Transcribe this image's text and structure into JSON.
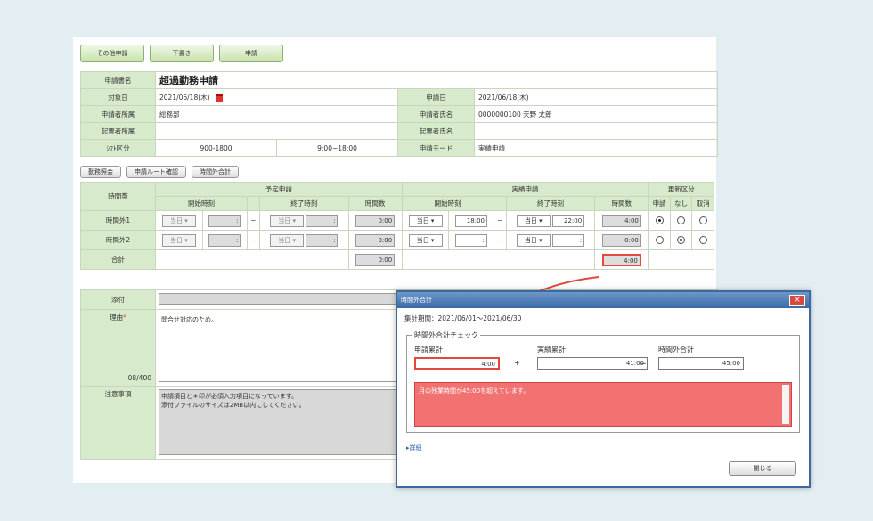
{
  "toolbar": {
    "other_label": "その他申請",
    "draft_label": "下書き",
    "apply_label": "申請"
  },
  "form": {
    "title_label": "申請書名",
    "title_value": "超過勤務申請",
    "target_date_label": "対象日",
    "target_date_value": "2021/06/18(木)",
    "apply_date_label": "申請日",
    "apply_date_value": "2021/06/18(木)",
    "dept_label": "申請者所属",
    "dept_value": "総務部",
    "applicant_label": "申請者氏名",
    "applicant_value": "0000000100 天野 太郎",
    "drafter_dept_label": "起票者所属",
    "drafter_dept_value": "",
    "drafter_label": "起票者氏名",
    "drafter_value": "",
    "shift_label": "ｼﾌﾄ区分",
    "shift_code": "900-1800",
    "shift_time": "9:00~18:00",
    "mode_label": "申請モード",
    "mode_value": "実績申請"
  },
  "subbuttons": {
    "b1": "勤務照会",
    "b2": "申請ルート確認",
    "b3": "時間外合計"
  },
  "grid": {
    "period_label": "時間帯",
    "planned_label": "予定申請",
    "actual_label": "実績申請",
    "update_label": "更新区分",
    "start_label": "開始時刻",
    "end_label": "終了時刻",
    "hours_label": "時間数",
    "apply_label": "申請",
    "none_label": "なし",
    "cancel_label": "取消",
    "day_value": "当日",
    "blank_time": ":",
    "row1_label": "時間外1",
    "row1_planned_hours": "0:00",
    "row1_actual_start": "18:00",
    "row1_actual_end": "22:00",
    "row1_actual_hours": "4:00",
    "row2_label": "時間外2",
    "row2_planned_hours": "0:00",
    "row2_actual_hours": "0:00",
    "total_label": "合計",
    "total_planned": "0:00",
    "total_actual": "4:00"
  },
  "lower": {
    "attach_label": "添付",
    "reason_label": "理由",
    "reason_mark": "*",
    "reason_text": "問合せ対応のため。",
    "reason_count": "08/400",
    "notes_label": "注意事項",
    "notes_line1": "申請項目と＊印が必須入力項目になっています。",
    "notes_line2": "添付ファイルのサイズは2MB以内にしてください。"
  },
  "modal": {
    "title": "時間外合計",
    "close_glyph": "×",
    "period_text": "集計期間：2021/06/01～2021/06/30",
    "check_label": "時間外合計チェック",
    "applied_label": "申請累計",
    "applied_value": "4:00",
    "plus": "+",
    "actual_label": "実績累計",
    "actual_value": "41:00",
    "equals": "=",
    "total_label": "時間外合計",
    "total_value": "45:00",
    "alert_text": "月の残業時間が45:00を超えています。",
    "link_text": "▸詳細",
    "close_button": "閉じる",
    "accent": "#e2493b"
  }
}
